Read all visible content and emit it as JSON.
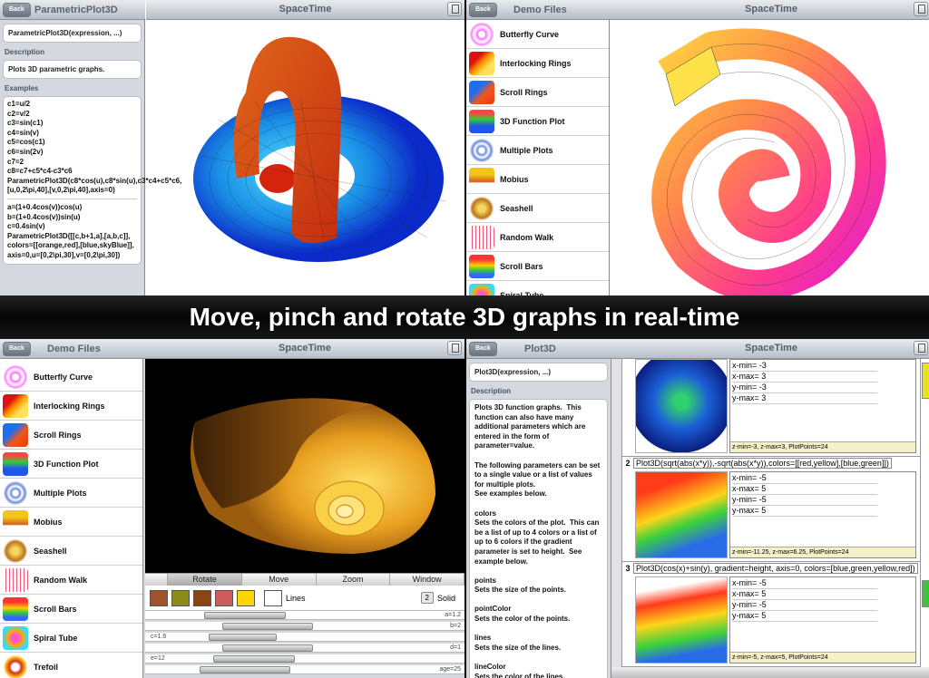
{
  "banner": "Move, pinch and rotate 3D graphs in real-time",
  "back_label": "Back",
  "q1": {
    "nav_left": "ParametricPlot3D",
    "nav_right": "SpaceTime",
    "signature": "ParametricPlot3D(expression, ...)",
    "desc_label": "Description",
    "desc": "Plots 3D parametric graphs.",
    "ex_label": "Examples",
    "code1": "c1=u/2\nc2=v/2\nc3=sin(c1)\nc4=sin(v)\nc5=cos(c1)\nc6=sin(2v)\nc7=2\nc8=c7+c5*c4-c3*c6\nParametricPlot3D(c8*cos(u),c8*sin(u),c3*c4+c5*c6,[u,0,2\\pi,40],[v,0,2\\pi,40],axis=0)",
    "code2": "a=(1+0.4cos(v))cos(u)\nb=(1+0.4cos(v))sin(u)\nc=0.4sin(v)\nParametricPlot3D([[c,b+1,a],[a,b,c]],\ncolors=[[orange,red],[blue,skyBlue]],\naxis=0,u=[0,2\\pi,30],v=[0,2\\pi,30])"
  },
  "q2": {
    "nav_left": "Demo Files",
    "nav_right": "SpaceTime"
  },
  "demo_items": [
    "Butterfly Curve",
    "Interlocking Rings",
    "Scroll Rings",
    "3D Function Plot",
    "Multiple Plots",
    "Mobius",
    "Seashell",
    "Random Walk",
    "Scroll Bars",
    "Spiral Tube",
    "Trefoil"
  ],
  "q3": {
    "nav_left": "Demo Files",
    "nav_right": "SpaceTime",
    "tabs": [
      "Rotate",
      "Move",
      "Zoom",
      "Window"
    ],
    "lines_label": "Lines",
    "solid_num": "2",
    "solid_label": "Solid",
    "sliders": [
      {
        "l": "",
        "r": "a=1.2"
      },
      {
        "l": "",
        "r": "b=2"
      },
      {
        "l": "c=1.6",
        "r": ""
      },
      {
        "l": "",
        "r": "d=1"
      },
      {
        "l": "e=12",
        "r": ""
      },
      {
        "l": "",
        "r": "age=25"
      }
    ],
    "swatches": [
      "#a0522d",
      "#8b8b1a",
      "#8b4513",
      "#cd5c5c",
      "#ffd700"
    ]
  },
  "q4": {
    "nav_left": "Plot3D",
    "nav_right": "SpaceTime",
    "signature": "Plot3D(expression, ...)",
    "desc_label": "Description",
    "desc": "Plots 3D function graphs.  This function can also have many additional parameters which are entered in the form of parameter=value.\n\nThe following parameters can be set to a single value or a list of values for multiple plots.\nSee examples below.\n\ncolors\nSets the colors of the plot.  This can be a list of up to 4 colors or a list of up to 6 colors if the gradient parameter is set to height.  See example below.\n\npoints\nSets the size of the points.\n\npointColor\nSets the color of the points.\n\nlines\nSets the size of the lines.\n\nlineColor\nSets the color of the lines.",
    "rows": [
      {
        "num": "",
        "cmd": "",
        "vals": [
          "x-min= -3",
          "x-max= 3",
          "y-min= -3",
          "y-max= 3"
        ],
        "foot": "z-min=-3, z-max=3, PlotPoints=24"
      },
      {
        "num": "2",
        "cmd": "Plot3D(sqrt(abs(x*y)),-sqrt(abs(x*y)),colors=[[red,yellow],[blue,green]])",
        "vals": [
          "x-min= -5",
          "x-max= 5",
          "y-min= -5",
          "y-max= 5"
        ],
        "foot": "z-min=-11.25, z-max=6.25, PlotPoints=24"
      },
      {
        "num": "3",
        "cmd": "Plot3D(cos(x)+sin(y), gradient=height, axis=0, colors=[blue,green,yellow,red])",
        "vals": [
          "x-min= -5",
          "x-max= 5",
          "y-min= -5",
          "y-max= 5"
        ],
        "foot": "z-min=-5, z-max=5, PlotPoints=24"
      }
    ]
  }
}
